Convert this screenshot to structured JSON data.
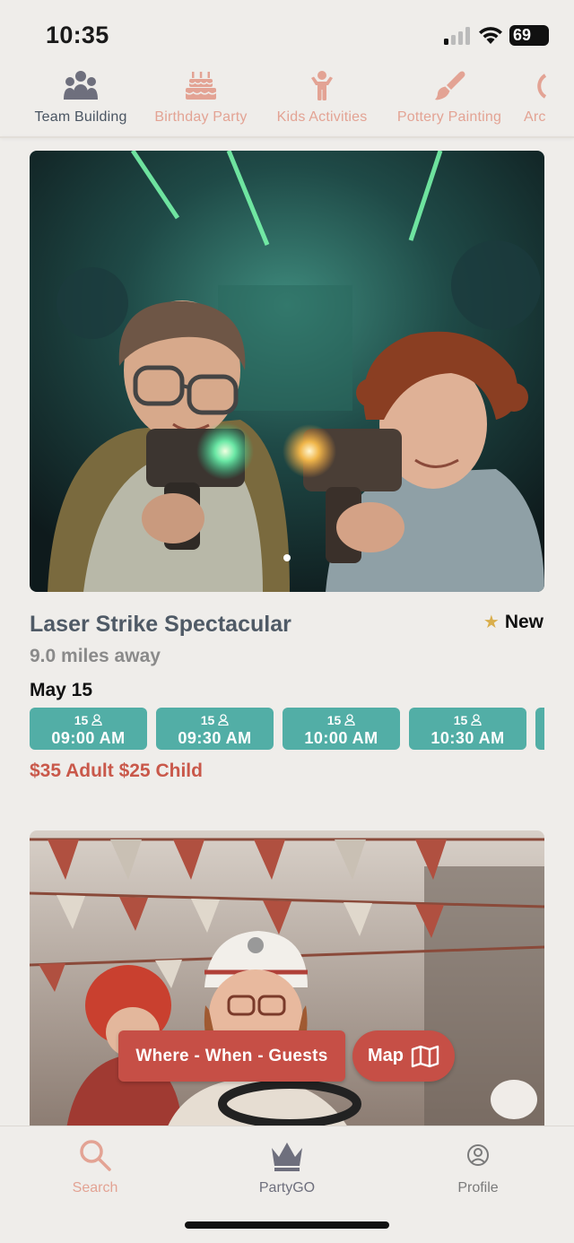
{
  "status_bar": {
    "time": "10:35",
    "battery": "69"
  },
  "categories": [
    {
      "label": "Team Building",
      "icon": "team-icon",
      "active": true
    },
    {
      "label": "Birthday Party",
      "icon": "cake-icon",
      "active": false
    },
    {
      "label": "Kids Activities",
      "icon": "child-icon",
      "active": false
    },
    {
      "label": "Pottery Painting",
      "icon": "brush-icon",
      "active": false
    },
    {
      "label": "Arc",
      "icon": "arcade-icon",
      "active": false
    }
  ],
  "listing": {
    "title": "Laser Strike Spectacular",
    "badge": "New",
    "distance": "9.0 miles away",
    "date": "May 15",
    "slots": [
      {
        "capacity": "15",
        "time": "09:00 AM"
      },
      {
        "capacity": "15",
        "time": "09:30 AM"
      },
      {
        "capacity": "15",
        "time": "10:00 AM"
      },
      {
        "capacity": "15",
        "time": "10:30 AM"
      }
    ],
    "price": "$35 Adult $25 Child"
  },
  "actions": {
    "filter_label": "Where - When - Guests",
    "map_label": "Map"
  },
  "bottom_nav": [
    {
      "label": "Search",
      "icon": "search-icon",
      "active": true
    },
    {
      "label": "PartyGO",
      "icon": "crown-icon",
      "active": false
    },
    {
      "label": "Profile",
      "icon": "profile-icon",
      "active": false
    }
  ],
  "colors": {
    "accent": "#c64f46",
    "teal": "#52aea6",
    "inactive_tab": "#e3a394",
    "active_tab": "#4a5562",
    "background": "#efedea"
  }
}
